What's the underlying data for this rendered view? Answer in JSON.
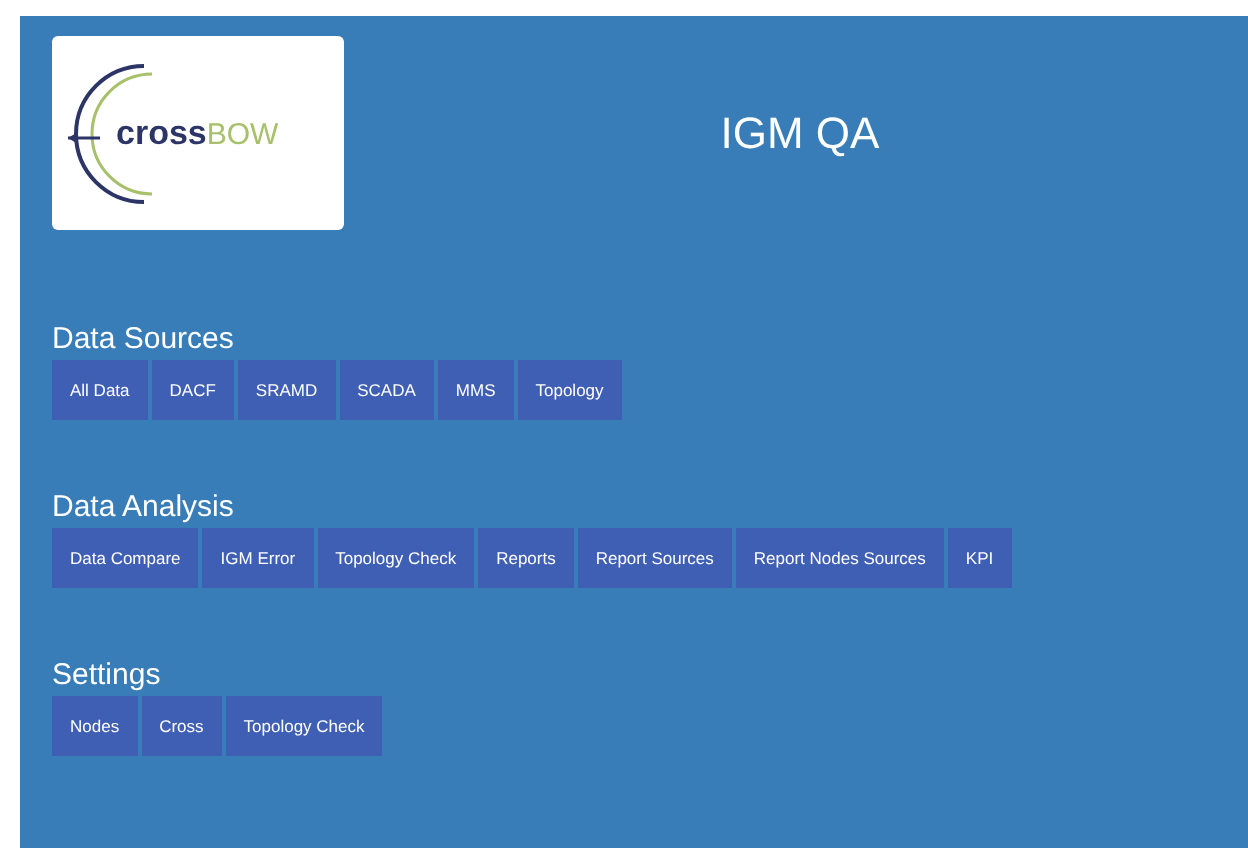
{
  "logo": {
    "text_main": "cross",
    "text_accent": "BOW"
  },
  "title": "IGM QA",
  "sections": [
    {
      "heading": "Data Sources",
      "buttons": [
        "All Data",
        "DACF",
        "SRAMD",
        "SCADA",
        "MMS",
        "Topology"
      ]
    },
    {
      "heading": "Data Analysis",
      "buttons": [
        "Data Compare",
        "IGM Error",
        "Topology Check",
        "Reports",
        "Report Sources",
        "Report Nodes Sources",
        "KPI"
      ]
    },
    {
      "heading": "Settings",
      "buttons": [
        "Nodes",
        "Cross",
        "Topology Check"
      ]
    }
  ]
}
